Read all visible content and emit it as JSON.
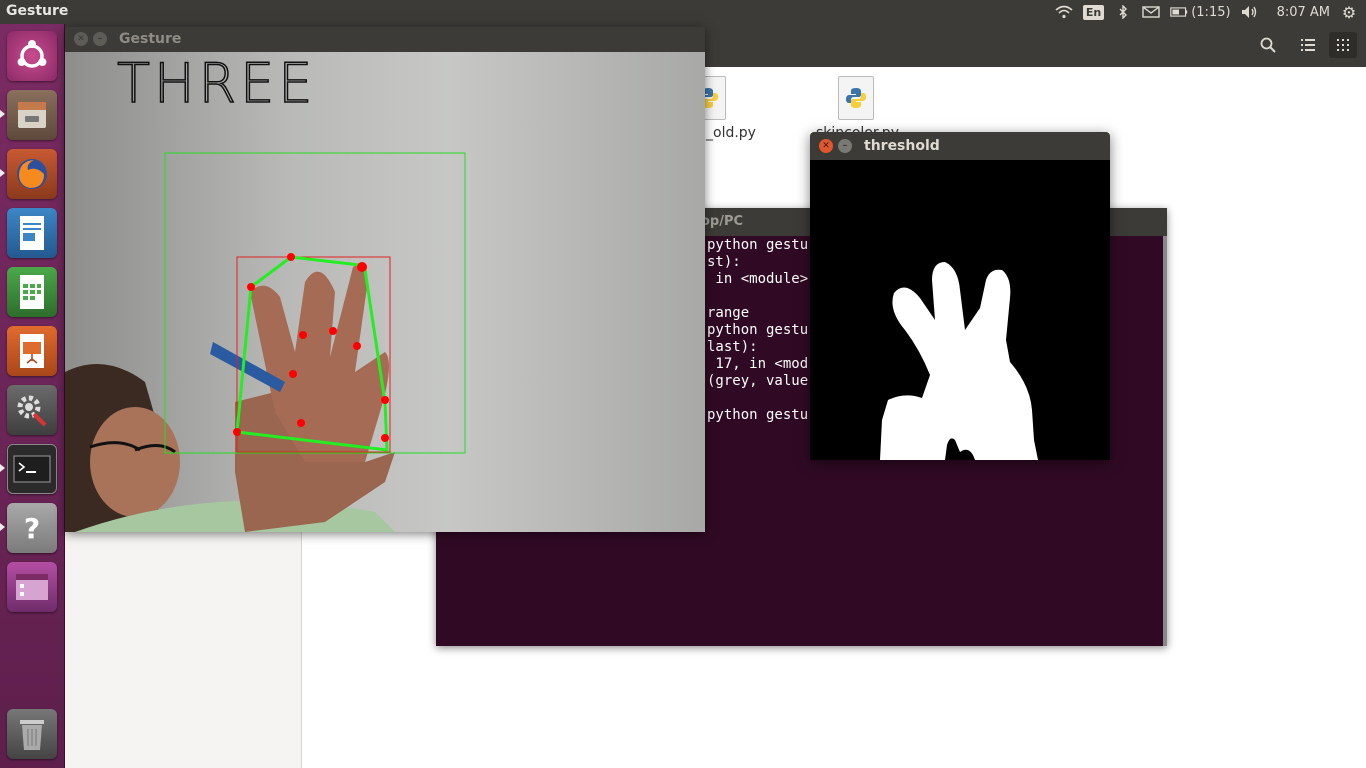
{
  "top_panel": {
    "app_title": "Gesture",
    "keyboard_layout": "En",
    "battery_text": "(1:15)",
    "clock": "8:07 AM",
    "icons": [
      "wifi-icon",
      "bluetooth-icon",
      "mail-icon",
      "battery-icon",
      "volume-icon",
      "settings-gear-icon"
    ]
  },
  "launcher": {
    "items": [
      "ubuntu-dash",
      "files",
      "firefox",
      "libreoffice-writer",
      "libreoffice-calc",
      "libreoffice-impress",
      "system-settings",
      "terminal",
      "help",
      "workspace-switcher",
      "trash"
    ]
  },
  "file_manager": {
    "files": [
      {
        "label": "_old.py"
      },
      {
        "label": "skincolor.py"
      }
    ]
  },
  "terminal": {
    "title_fragment": "op/PC",
    "lines": [
      "python gestu",
      "st):",
      " in <module>",
      "",
      "range",
      "python gestu",
      "last):",
      " 17, in <mod",
      "(grey, value",
      "",
      "python gestu"
    ]
  },
  "gesture_window": {
    "title": "Gesture",
    "overlay_text": "THREE",
    "colors": {
      "roi_box": "#22dd22",
      "bounding_box": "#e02020",
      "hull": "#22ee22",
      "points": "#ff0000"
    }
  },
  "threshold_window": {
    "title": "threshold"
  }
}
